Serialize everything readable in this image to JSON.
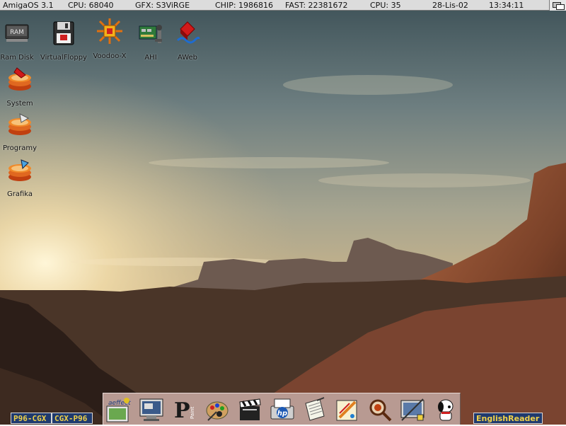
{
  "titlebar": {
    "os": "AmigaOS 3.1",
    "cpu_type": "CPU: 68040",
    "gfx": "GFX: S3ViRGE",
    "chip": "CHIP: 1986816",
    "fast": "FAST: 22381672",
    "cpu_load": "CPU: 35",
    "date": "28-Lis-02",
    "time": "13:34:11"
  },
  "desktop": {
    "icons": [
      {
        "label": "Ram Disk",
        "icon": "ram-disk-icon"
      },
      {
        "label": "VirtualFloppy",
        "icon": "floppy-icon"
      },
      {
        "label": "Voodoo-X",
        "icon": "voodoo-icon"
      },
      {
        "label": "AHI",
        "icon": "ahi-icon"
      },
      {
        "label": "AWeb",
        "icon": "aweb-icon"
      },
      {
        "label": "System",
        "icon": "drawer-icon"
      },
      {
        "label": "Programy",
        "icon": "drawer-icon"
      },
      {
        "label": "Grafika",
        "icon": "drawer-icon"
      }
    ]
  },
  "dock": {
    "items": [
      {
        "name": "art-effect-icon",
        "text": "Art Effect"
      },
      {
        "name": "monitor-icon"
      },
      {
        "name": "personal-paint-icon",
        "text": "Paint"
      },
      {
        "name": "paint-palette-icon"
      },
      {
        "name": "clapperboard-icon"
      },
      {
        "name": "hp-printer-icon",
        "text": "hp"
      },
      {
        "name": "notepad-icon"
      },
      {
        "name": "pencil-tools-icon"
      },
      {
        "name": "magnifier-icon"
      },
      {
        "name": "screenshot-tool-icon"
      },
      {
        "name": "snoopy-icon"
      }
    ]
  },
  "bottom": {
    "mode1": "P96-CGX",
    "mode2": "CGX-P96",
    "reader": "EnglishReader"
  },
  "colors": {
    "titlebar_bg": "#dcdcdc",
    "dock_bg": "#b89a92",
    "gadget_bg": "#1f3a6e",
    "gadget_text": "#f0d24a"
  }
}
